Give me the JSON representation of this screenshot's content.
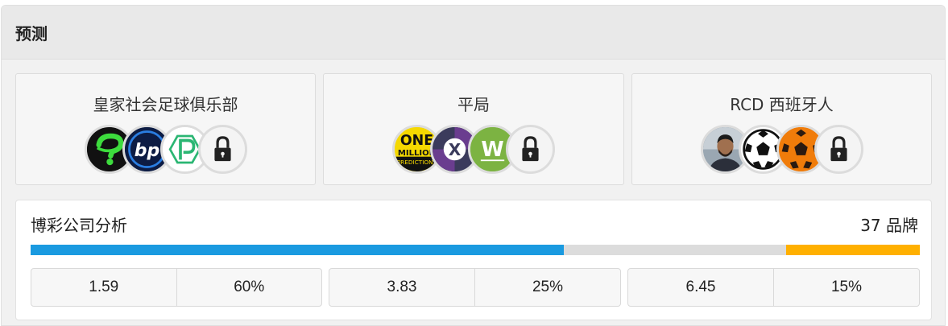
{
  "header": {
    "title": "预测"
  },
  "predictions": [
    {
      "label": "皇家社会足球俱乐部",
      "avatars": [
        "question-mark-logo",
        "bp-logo",
        "p-logo"
      ],
      "locked": true
    },
    {
      "label": "平局",
      "avatars": [
        "one-million-predictions-logo",
        "x-logo",
        "w-logo"
      ],
      "locked": true
    },
    {
      "label": "RCD 西班牙人",
      "avatars": [
        "person-avatar",
        "soccer-ball-logo",
        "orange-soccer-ball-logo"
      ],
      "locked": true
    }
  ],
  "avatar_text": {
    "bp": "bp",
    "one_million": "ONE",
    "one_million_2": "MILLION",
    "one_million_3": "PREDICTIONS",
    "x": "X",
    "w": "W"
  },
  "bookmaker": {
    "title": "博彩公司分析",
    "count_label": "37 品牌",
    "distribution": [
      {
        "outcome": "home",
        "percent": 60,
        "color": "#1a9ae0"
      },
      {
        "outcome": "draw",
        "percent": 25,
        "color": "#dcdcdc"
      },
      {
        "outcome": "away",
        "percent": 15,
        "color": "#ffb000"
      }
    ],
    "odds": [
      {
        "odd": "1.59",
        "pct": "60%"
      },
      {
        "odd": "3.83",
        "pct": "25%"
      },
      {
        "odd": "6.45",
        "pct": "15%"
      }
    ]
  }
}
